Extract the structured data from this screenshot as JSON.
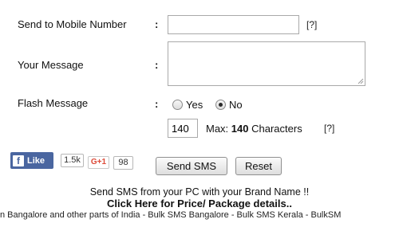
{
  "form": {
    "mobile_label": "Send to Mobile Number",
    "colon": ":",
    "mobile_help": "[?]",
    "message_label": "Your Message",
    "flash_label": "Flash Message",
    "flash_options": [
      {
        "label": "Yes",
        "selected": false
      },
      {
        "label": "No",
        "selected": true
      }
    ],
    "char_count": "140",
    "max_prefix": "Max:",
    "max_value": "140",
    "max_suffix": "Characters",
    "char_help": "[?]"
  },
  "social": {
    "fb_icon": "f",
    "fb_like_label": "Like",
    "fb_count": "1.5k",
    "gplus_label": "G+1",
    "gplus_count": "98"
  },
  "buttons": {
    "send_label": "Send SMS",
    "reset_label": "Reset"
  },
  "footer": {
    "tagline": "Send SMS from your PC with your Brand Name !!",
    "price_link": "Click Here for Price/ Package details..",
    "marquee": "n Bangalore and other parts of India - Bulk SMS Bangalore - Bulk SMS Kerala - BulkSM"
  }
}
